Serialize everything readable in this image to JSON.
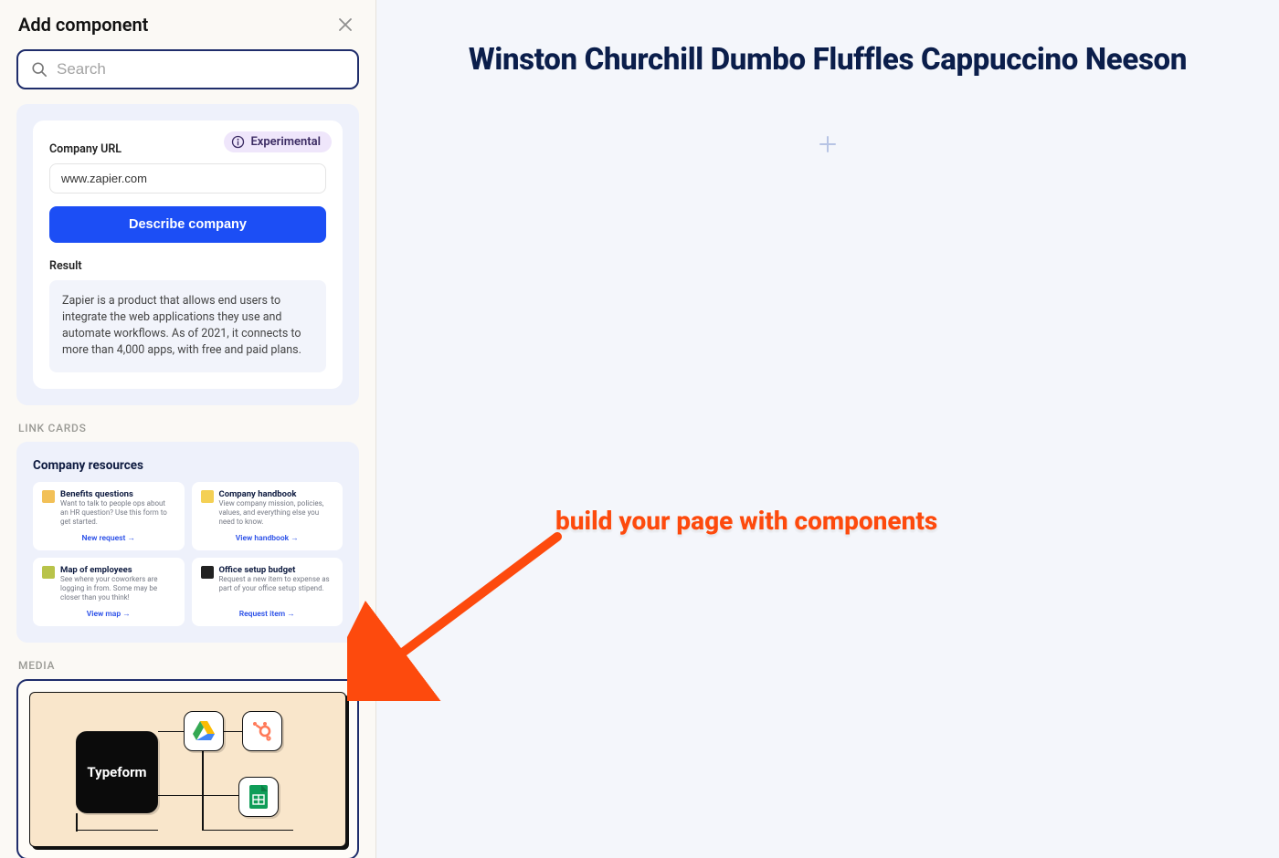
{
  "sidebar": {
    "title": "Add component",
    "search_placeholder": "Search"
  },
  "ai_preview": {
    "badge": "Experimental",
    "url_label": "Company URL",
    "url_value": "www.zapier.com",
    "button": "Describe company",
    "result_label": "Result",
    "result_text": "Zapier is a product that allows end users to integrate the web applications they use and automate workflows. As of 2021, it connects to more than 4,000 apps, with free and paid plans."
  },
  "sections": {
    "link_cards": "LINK CARDS",
    "media": "MEDIA"
  },
  "link_cards": {
    "heading": "Company resources",
    "cards": [
      {
        "title": "Benefits questions",
        "desc": "Want to talk to people ops about an HR question? Use this form to get started.",
        "cta": "New request  →",
        "icon_color": "#f2c057"
      },
      {
        "title": "Company handbook",
        "desc": "View company mission, policies, values, and everything else you need to know.",
        "cta": "View handbook  →",
        "icon_color": "#f4d054"
      },
      {
        "title": "Map of employees",
        "desc": "See where your coworkers are logging in from. Some may be closer than you think!",
        "cta": "View map  →",
        "icon_color": "#b8c34a"
      },
      {
        "title": "Office setup budget",
        "desc": "Request a new item to expense as part of your office setup stipend.",
        "cta": "Request item  →",
        "icon_color": "#222222"
      }
    ]
  },
  "media_scene": {
    "typeform_label": "Typeform"
  },
  "canvas": {
    "page_title": "Winston Churchill Dumbo Fluffles Cappuccino Neeson"
  },
  "annotation": {
    "text": "build your page with components"
  }
}
